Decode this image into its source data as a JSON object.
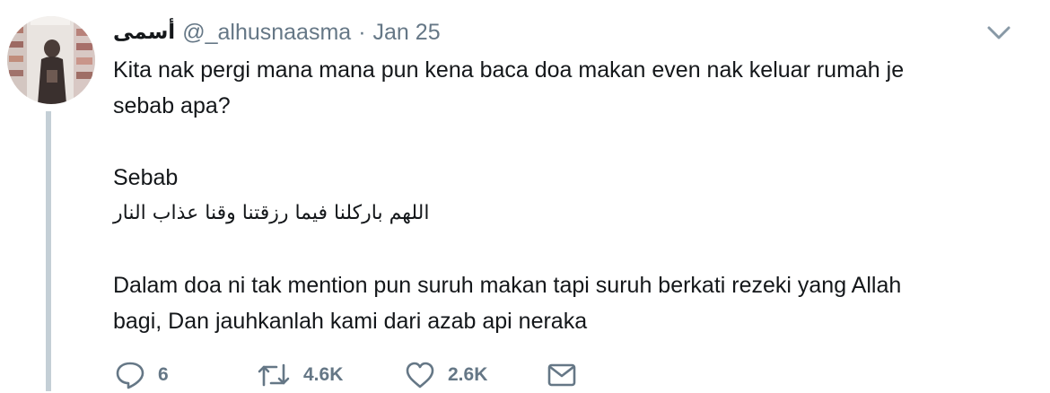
{
  "tweet": {
    "author": {
      "display_name": "أسمى",
      "handle": "@_alhusnaasma",
      "avatar_icon": "avatar-photo"
    },
    "separator": "·",
    "timestamp": "Jan 25",
    "caret_icon": "chevron-down-icon",
    "text": {
      "line1": "Kita nak pergi mana mana pun kena baca doa makan even nak keluar rumah je",
      "line2": "sebab apa?",
      "line3": "Sebab",
      "arabic": "اللهم باركلنا فيما رزقتنا وقنا عذاب النار",
      "line4": "Dalam doa ni tak mention pun suruh makan tapi suruh berkati rezeki yang Allah",
      "line5": "bagi, Dan jauhkanlah kami dari azab api neraka"
    },
    "actions": {
      "reply": {
        "icon": "reply-icon",
        "count": "6"
      },
      "retweet": {
        "icon": "retweet-icon",
        "count": "4.6K"
      },
      "like": {
        "icon": "heart-icon",
        "count": "2.6K"
      },
      "dm": {
        "icon": "envelope-icon"
      }
    },
    "colors": {
      "text": "#14171a",
      "secondary": "#657786",
      "thread_line": "#c4cfd6"
    }
  }
}
